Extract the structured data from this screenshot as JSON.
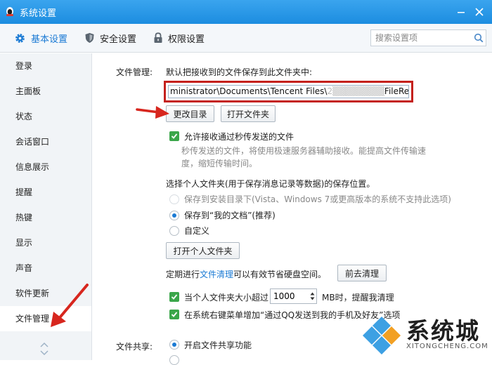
{
  "window": {
    "title": "系统设置"
  },
  "tabs": [
    {
      "label": "基本设置",
      "icon": "gear-icon",
      "active": true
    },
    {
      "label": "安全设置",
      "icon": "shield-icon",
      "active": false
    },
    {
      "label": "权限设置",
      "icon": "lock-icon",
      "active": false
    }
  ],
  "search": {
    "placeholder": "搜索设置项"
  },
  "sidebar": {
    "items": [
      {
        "label": "登录"
      },
      {
        "label": "主面板"
      },
      {
        "label": "状态"
      },
      {
        "label": "会话窗口"
      },
      {
        "label": "信息展示"
      },
      {
        "label": "提醒"
      },
      {
        "label": "热键"
      },
      {
        "label": "显示"
      },
      {
        "label": "声音"
      },
      {
        "label": "软件更新"
      },
      {
        "label": "文件管理"
      }
    ],
    "active_index": 10
  },
  "file_management": {
    "section_label": "文件管理:",
    "save_desc": "默认把接收到的文件保存到此文件夹中:",
    "path_prefix": "ministrator\\Documents\\Tencent Files\\",
    "path_obscured": "2",
    "path_suffix": "FileRecv\\",
    "change_dir_button": "更改目录",
    "open_folder_button": "打开文件夹",
    "allow_seconds": {
      "label": "允许接收通过秒传发送的文件",
      "checked": true
    },
    "allow_seconds_desc_1": "秒传发送的文件，将使用极速服务器辅助接收。能提高文件传输速",
    "allow_seconds_desc_2": "度，缩短传输时间。",
    "personal_folder_desc": "选择个人文件夹(用于保存消息记录等数据)的保存位置。",
    "radio_install": "保存到安装目录下(Vista、Windows 7或更高版本的系统不支持此选项)",
    "radio_my_docs": "保存到“我的文档”(推荐)",
    "radio_custom": "自定义",
    "radio_selected": "my_docs",
    "open_personal_button": "打开个人文件夹",
    "cleanup_prefix": "定期进行",
    "cleanup_link": "文件清理",
    "cleanup_suffix": "可以有效节省硬盘空间。",
    "cleanup_button": "前去清理",
    "size_check_prefix": "当个人文件夹大小超过",
    "size_value": "1000",
    "size_check_suffix": "MB时，提醒我清理",
    "size_check_checked": true,
    "context_menu_label": "在系统右键菜单增加“通过QQ发送到我的手机及好友”选项",
    "context_menu_checked": true
  },
  "file_share": {
    "section_label": "文件共享:",
    "enable_label": "开启文件共享功能",
    "enabled": true
  },
  "watermark": {
    "text": "系统城",
    "url": "XITONGCHENG.COM"
  },
  "colors": {
    "accent": "#1a7ad4",
    "titlebar": "#1c8de0",
    "highlight": "#c4201c",
    "check": "#3aa64a"
  }
}
